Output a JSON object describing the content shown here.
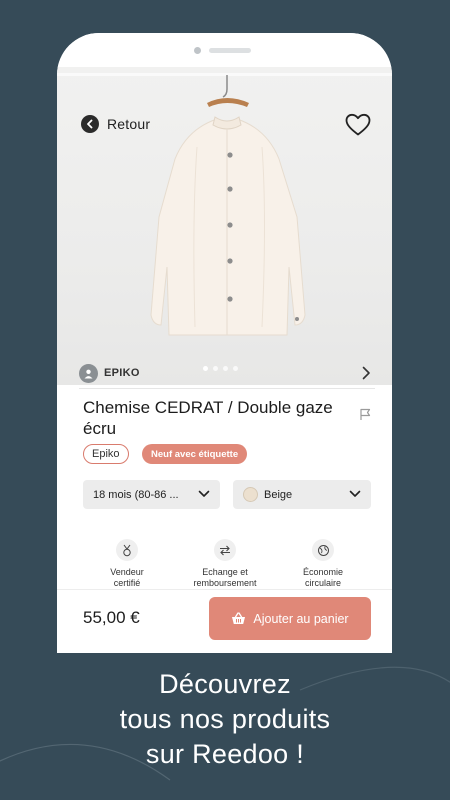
{
  "app": {
    "back_label": "Retour",
    "seller_name": "EPIKO",
    "product_title_line1": "Chemise CEDRAT / Double gaze",
    "product_title_line2": "écru",
    "brand_tag": "Epiko",
    "condition_tag": "Neuf avec étiquette",
    "size_select": "18 mois  (80-86 ...",
    "color_select": "Beige",
    "features": [
      {
        "label_1": "Vendeur",
        "label_2": "certifié",
        "icon": "medal-icon"
      },
      {
        "label_1": "Echange et",
        "label_2": "remboursement",
        "icon": "exchange-arrows-icon"
      },
      {
        "label_1": "Économie",
        "label_2": "circulaire",
        "icon": "globe-icon"
      }
    ],
    "price": "55,00 €",
    "add_to_cart_label": "Ajouter au panier",
    "image_carousel": {
      "count": 4,
      "active_index": 0
    }
  },
  "tagline": {
    "line1": "Découvrez",
    "line2": "tous nos produits",
    "line3": "sur Reedoo !"
  },
  "colors": {
    "background": "#364b58",
    "accent": "#e08878",
    "swatch_beige": "#ece0cf"
  }
}
